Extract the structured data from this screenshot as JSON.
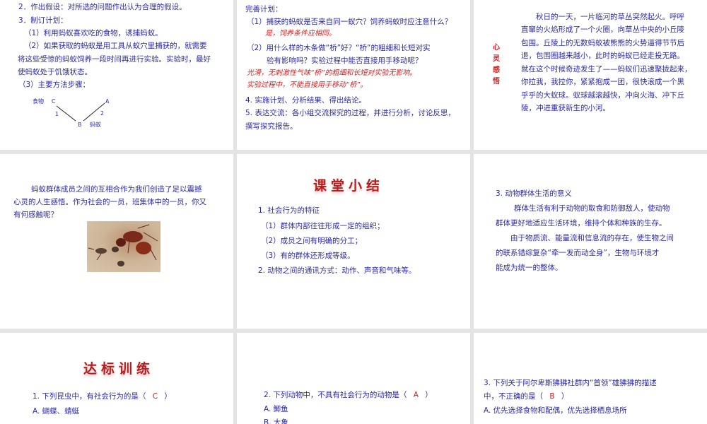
{
  "slides": [
    {
      "lines": [
        "2．作出假设：对所选的问题作出认为合理的假设。",
        "3．制订计划：",
        "（1）利用蚂蚁喜欢吃的食物，诱捕蚂蚁。",
        "（2）如果获取的蚂蚁是用工具从蚁穴里捕获的，就需要",
        "将这些受惊的蚂蚁饲养一段时间再进行实验。实验时，最好",
        "使蚂蚁处于饥饿状态。",
        "（3）主要方法步骤："
      ],
      "diagram": {
        "food": "食物",
        "c": "C",
        "a": "A",
        "b": "B",
        "ant": "蚂蚁",
        "n1": "1",
        "n2": "2"
      }
    },
    {
      "lines": [
        "完善计划：",
        "（1）捕获的蚂蚁是否来自同一蚁穴？饲养蚂蚁时应注意什么？",
        "（2）用什么样的木条做“桥”好？“桥”的粗细和长短对实",
        "验有影响吗？实验过程中能否直接用手移动呢？",
        "4. 实施计划、分析结果、得出结论。",
        "5. 表达交流：各小组交流探究的过程，并进行分析，讨论反思，",
        "撰写探究报告。"
      ],
      "answers": [
        "是，饲养条件应相同。",
        "光滑，无刺激性气味“桥”的粗细和长短对实验无影响。",
        "实验过程中，不能直接用手移动“桥”。"
      ]
    },
    {
      "side_label": "心灵感悟",
      "lines": [
        "秋日的一天，一片临河的草丛突然起火。呼呼",
        "直窜的火焰形成了一个火圈，向草丛中央的小丘陵",
        "包围。丘陵上的无数蚂蚁被熊熊的火势逼得节节后",
        "退，包围圈越来越小，此时的蚂蚁已经走投无路。",
        "就在这个时候奇迹发生了——蚂蚁们迅速聚拢起来，",
        "你拉我，我拉你，紧紧抱成一团，很快滚成一个黑",
        "乎乎的大蚁球。蚁球越滚越快，冲向火海、冲下丘",
        "陵，冲进重获新生的小河。"
      ]
    },
    {
      "lines": [
        "蚂蚁群体成员之间的互相合作为我们创造了足以震撼",
        "心灵的人生感悟。作为社会的一员，班集体中的一员，你又",
        "有何感触呢？"
      ]
    },
    {
      "title": "课堂小结",
      "lines": [
        "1. 社会行为的特征",
        "（1）群体内部往往形成一定的组织；",
        "（2）成员之间有明确的分工；",
        "（3）有的群体还形成等级。",
        "2. 动物之间的通讯方式：动作、声音和气味等。"
      ]
    },
    {
      "lines": [
        "3. 动物群体生活的意义",
        "群体生活有利于动物的取食和防御敌人，使动物",
        "群体更好地适应生活环境，维持个体和种族的生存。",
        "由于物质流、能量流和信息流的存在，使生物之间",
        "的联系错综复杂“牵一发而动全身”，生物与环境才",
        "能成为统一的整体。"
      ]
    },
    {
      "title": "达标训练",
      "question": "1. 下列昆虫中，有社会行为的是（",
      "answer": "C",
      "close": "）",
      "options": [
        "A. 蝴蝶、蜻蜓"
      ]
    },
    {
      "question": "2. 下列动物中，不具有社会行为的动物是（",
      "answer": "A",
      "close": "）",
      "options": [
        "A. 鲫鱼",
        "B. 大象"
      ]
    },
    {
      "question": "3. 下列关于阿尔卑斯狒狒社群内“首领”雄狒狒的描述",
      "question2": "中，不正确的是（",
      "answer": "B",
      "close": "）",
      "options": [
        "A. 优先选择食物和配偶，优先选择栖息场所"
      ]
    }
  ],
  "colors": {
    "text": "#2a2aa8",
    "answer": "#d42020",
    "title": "#b81c1c",
    "background": "#e4e4e4"
  }
}
